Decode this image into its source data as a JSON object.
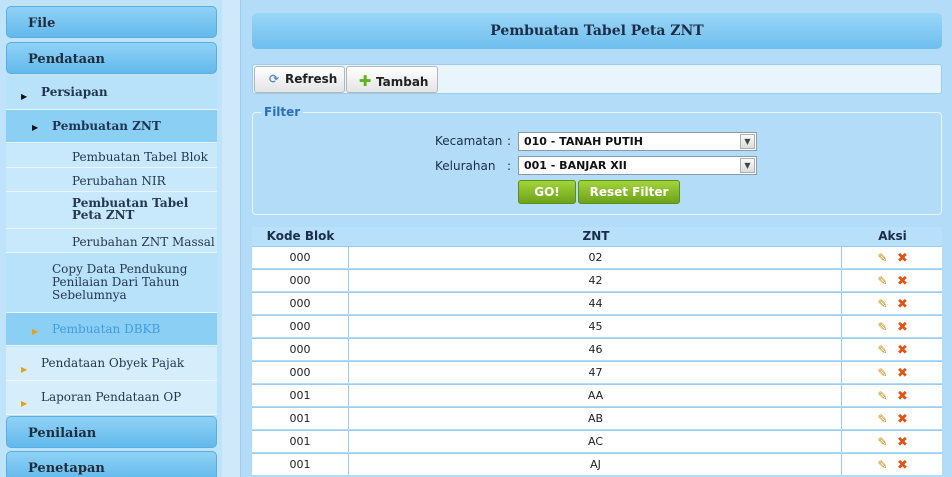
{
  "sidebar": {
    "file": "File",
    "pendataan": "Pendataan",
    "persiapan": "Persiapan",
    "pembuatan_znt": "Pembuatan ZNT",
    "sub_items": [
      "Pembuatan Tabel Blok",
      "Perubahan NIR",
      "Pembuatan Tabel Peta ZNT",
      "Perubahan ZNT Massal"
    ],
    "copy_data": "Copy Data Pendukung Penilaian Dari Tahun Sebelumnya",
    "pembuatan_dbkb": "Pembuatan DBKB",
    "pendataan_obyek": "Pendataan Obyek Pajak",
    "laporan": "Laporan Pendataan OP",
    "penilaian": "Penilaian",
    "penetapan": "Penetapan"
  },
  "main": {
    "title": "Pembuatan Tabel Peta ZNT",
    "toolbar": {
      "refresh": "Refresh",
      "tambah": "Tambah"
    },
    "filter": {
      "legend": "Filter",
      "kecamatan_label": "Kecamatan",
      "kecamatan_value": "010 - TANAH PUTIH",
      "kelurahan_label": "Kelurahan",
      "kelurahan_value": "001 - BANJAR XII",
      "colon": ":",
      "go": "GO!",
      "reset": "Reset Filter"
    },
    "table": {
      "headers": [
        "Kode Blok",
        "ZNT",
        "Aksi"
      ],
      "rows": [
        [
          "000",
          "02"
        ],
        [
          "000",
          "42"
        ],
        [
          "000",
          "44"
        ],
        [
          "000",
          "45"
        ],
        [
          "000",
          "46"
        ],
        [
          "000",
          "47"
        ],
        [
          "001",
          "AA"
        ],
        [
          "001",
          "AB"
        ],
        [
          "001",
          "AC"
        ],
        [
          "001",
          "AJ"
        ]
      ]
    }
  }
}
